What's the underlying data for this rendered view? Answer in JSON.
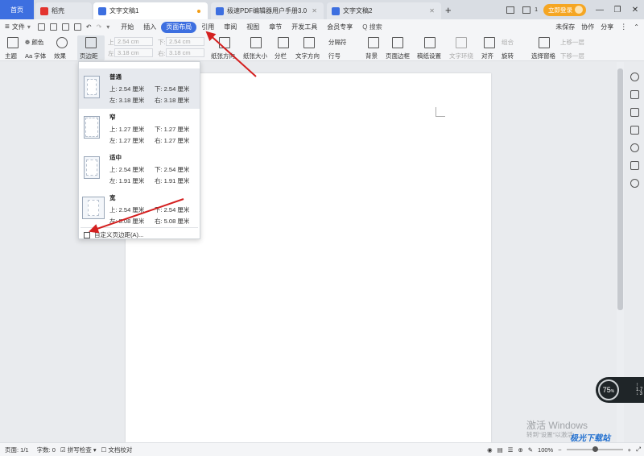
{
  "tabs": [
    {
      "label": "首页"
    },
    {
      "label": "稻壳"
    },
    {
      "label": "文字文稿1"
    },
    {
      "label": "极速PDF编辑器用户手册3.0"
    },
    {
      "label": "文字文稿2"
    }
  ],
  "titlebar": {
    "login_label": "立即登录",
    "count": "1"
  },
  "menu": {
    "file_label": "文件",
    "items": [
      "开始",
      "插入",
      "页面布局",
      "引用",
      "审阅",
      "视图",
      "章节",
      "开发工具",
      "会员专享"
    ],
    "search_label": "Q 搜索",
    "unsaved": "未保存",
    "collab": "协作",
    "share": "分享"
  },
  "ribbon": {
    "theme": "主题",
    "color": "颜色",
    "font": "Aa 字体",
    "effect": "效果",
    "page_margin": "页边距",
    "top_label": "上:",
    "top_value": "2.54 cm",
    "bottom_label": "下:",
    "bottom_value": "2.54 cm",
    "left_label": "左:",
    "left_value": "3.18 cm",
    "right_label": "右:",
    "right_value": "3.18 cm",
    "orientation": "纸张方向",
    "size": "纸张大小",
    "columns": "分栏",
    "text_direction": "文字方向",
    "line_number": "行号",
    "section_break": "分隔符",
    "background": "背景",
    "page_border": "页面边框",
    "draft_settings": "稿纸设置",
    "text_wrap": "文字环绕",
    "align": "对齐",
    "rotate": "旋转",
    "select_pane": "选择窗格",
    "group": "组合",
    "bring_forward": "上移一层",
    "send_backward": "下移一层"
  },
  "margin_presets": [
    {
      "name": "普通",
      "top": "上: 2.54 厘米",
      "bottom": "下: 2.54 厘米",
      "left": "左: 3.18 厘米",
      "right": "右: 3.18 厘米"
    },
    {
      "name": "窄",
      "top": "上: 1.27 厘米",
      "bottom": "下: 1.27 厘米",
      "left": "左: 1.27 厘米",
      "right": "右: 1.27 厘米"
    },
    {
      "name": "适中",
      "top": "上: 2.54 厘米",
      "bottom": "下: 2.54 厘米",
      "left": "左: 1.91 厘米",
      "right": "右: 1.91 厘米"
    },
    {
      "name": "宽",
      "top": "上: 2.54 厘米",
      "bottom": "下: 2.54 厘米",
      "left": "左: 5.08 厘米",
      "right": "右: 5.08 厘米"
    }
  ],
  "custom_margin_label": "自定义页边距(A)...",
  "status": {
    "page": "页面: 1/1",
    "words": "字数: 0",
    "spell": "拼写检查",
    "proof": "文档校对",
    "zoom": "100%"
  },
  "speed_widget": {
    "value": "75",
    "unit": "%",
    "up": "1.7",
    "down": "3"
  },
  "watermark": {
    "line1": "激活 Windows",
    "line2": "转到\"设置\"以激活",
    "logo": "极光下载站"
  },
  "colors": {
    "accent": "#3d6fe0",
    "arrow": "#d42020",
    "login": "#f5a623"
  }
}
